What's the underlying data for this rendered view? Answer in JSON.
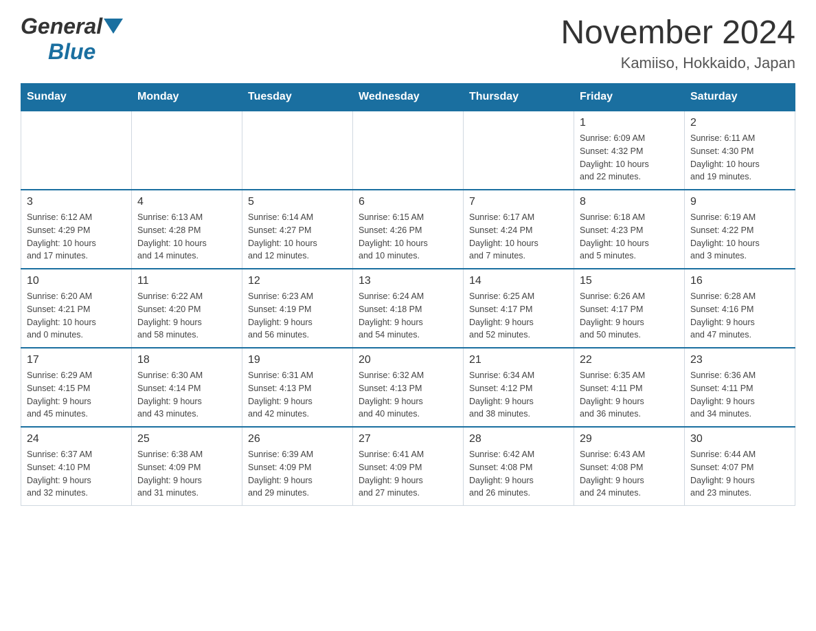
{
  "logo": {
    "general_text": "General",
    "blue_text": "Blue"
  },
  "header": {
    "title": "November 2024",
    "subtitle": "Kamiiso, Hokkaido, Japan"
  },
  "weekdays": [
    "Sunday",
    "Monday",
    "Tuesday",
    "Wednesday",
    "Thursday",
    "Friday",
    "Saturday"
  ],
  "weeks": [
    [
      {
        "day": "",
        "info": ""
      },
      {
        "day": "",
        "info": ""
      },
      {
        "day": "",
        "info": ""
      },
      {
        "day": "",
        "info": ""
      },
      {
        "day": "",
        "info": ""
      },
      {
        "day": "1",
        "info": "Sunrise: 6:09 AM\nSunset: 4:32 PM\nDaylight: 10 hours\nand 22 minutes."
      },
      {
        "day": "2",
        "info": "Sunrise: 6:11 AM\nSunset: 4:30 PM\nDaylight: 10 hours\nand 19 minutes."
      }
    ],
    [
      {
        "day": "3",
        "info": "Sunrise: 6:12 AM\nSunset: 4:29 PM\nDaylight: 10 hours\nand 17 minutes."
      },
      {
        "day": "4",
        "info": "Sunrise: 6:13 AM\nSunset: 4:28 PM\nDaylight: 10 hours\nand 14 minutes."
      },
      {
        "day": "5",
        "info": "Sunrise: 6:14 AM\nSunset: 4:27 PM\nDaylight: 10 hours\nand 12 minutes."
      },
      {
        "day": "6",
        "info": "Sunrise: 6:15 AM\nSunset: 4:26 PM\nDaylight: 10 hours\nand 10 minutes."
      },
      {
        "day": "7",
        "info": "Sunrise: 6:17 AM\nSunset: 4:24 PM\nDaylight: 10 hours\nand 7 minutes."
      },
      {
        "day": "8",
        "info": "Sunrise: 6:18 AM\nSunset: 4:23 PM\nDaylight: 10 hours\nand 5 minutes."
      },
      {
        "day": "9",
        "info": "Sunrise: 6:19 AM\nSunset: 4:22 PM\nDaylight: 10 hours\nand 3 minutes."
      }
    ],
    [
      {
        "day": "10",
        "info": "Sunrise: 6:20 AM\nSunset: 4:21 PM\nDaylight: 10 hours\nand 0 minutes."
      },
      {
        "day": "11",
        "info": "Sunrise: 6:22 AM\nSunset: 4:20 PM\nDaylight: 9 hours\nand 58 minutes."
      },
      {
        "day": "12",
        "info": "Sunrise: 6:23 AM\nSunset: 4:19 PM\nDaylight: 9 hours\nand 56 minutes."
      },
      {
        "day": "13",
        "info": "Sunrise: 6:24 AM\nSunset: 4:18 PM\nDaylight: 9 hours\nand 54 minutes."
      },
      {
        "day": "14",
        "info": "Sunrise: 6:25 AM\nSunset: 4:17 PM\nDaylight: 9 hours\nand 52 minutes."
      },
      {
        "day": "15",
        "info": "Sunrise: 6:26 AM\nSunset: 4:17 PM\nDaylight: 9 hours\nand 50 minutes."
      },
      {
        "day": "16",
        "info": "Sunrise: 6:28 AM\nSunset: 4:16 PM\nDaylight: 9 hours\nand 47 minutes."
      }
    ],
    [
      {
        "day": "17",
        "info": "Sunrise: 6:29 AM\nSunset: 4:15 PM\nDaylight: 9 hours\nand 45 minutes."
      },
      {
        "day": "18",
        "info": "Sunrise: 6:30 AM\nSunset: 4:14 PM\nDaylight: 9 hours\nand 43 minutes."
      },
      {
        "day": "19",
        "info": "Sunrise: 6:31 AM\nSunset: 4:13 PM\nDaylight: 9 hours\nand 42 minutes."
      },
      {
        "day": "20",
        "info": "Sunrise: 6:32 AM\nSunset: 4:13 PM\nDaylight: 9 hours\nand 40 minutes."
      },
      {
        "day": "21",
        "info": "Sunrise: 6:34 AM\nSunset: 4:12 PM\nDaylight: 9 hours\nand 38 minutes."
      },
      {
        "day": "22",
        "info": "Sunrise: 6:35 AM\nSunset: 4:11 PM\nDaylight: 9 hours\nand 36 minutes."
      },
      {
        "day": "23",
        "info": "Sunrise: 6:36 AM\nSunset: 4:11 PM\nDaylight: 9 hours\nand 34 minutes."
      }
    ],
    [
      {
        "day": "24",
        "info": "Sunrise: 6:37 AM\nSunset: 4:10 PM\nDaylight: 9 hours\nand 32 minutes."
      },
      {
        "day": "25",
        "info": "Sunrise: 6:38 AM\nSunset: 4:09 PM\nDaylight: 9 hours\nand 31 minutes."
      },
      {
        "day": "26",
        "info": "Sunrise: 6:39 AM\nSunset: 4:09 PM\nDaylight: 9 hours\nand 29 minutes."
      },
      {
        "day": "27",
        "info": "Sunrise: 6:41 AM\nSunset: 4:09 PM\nDaylight: 9 hours\nand 27 minutes."
      },
      {
        "day": "28",
        "info": "Sunrise: 6:42 AM\nSunset: 4:08 PM\nDaylight: 9 hours\nand 26 minutes."
      },
      {
        "day": "29",
        "info": "Sunrise: 6:43 AM\nSunset: 4:08 PM\nDaylight: 9 hours\nand 24 minutes."
      },
      {
        "day": "30",
        "info": "Sunrise: 6:44 AM\nSunset: 4:07 PM\nDaylight: 9 hours\nand 23 minutes."
      }
    ]
  ]
}
